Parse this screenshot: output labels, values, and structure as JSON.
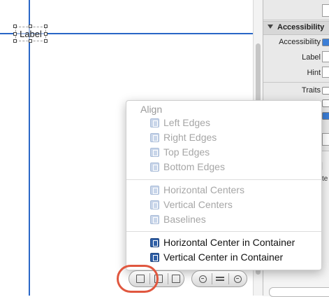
{
  "canvas": {
    "label_text": "Label"
  },
  "inspector": {
    "section_title": "Accessibility",
    "rows": {
      "accessibility": "Accessibility",
      "label": "Label",
      "hint": "Hint",
      "traits": "Traits"
    },
    "lower_fragment": "te"
  },
  "align_menu": {
    "title": "Align",
    "disabled_items": [
      {
        "label": "Left Edges",
        "icon": "align-left-edges-icon"
      },
      {
        "label": "Right Edges",
        "icon": "align-right-edges-icon"
      },
      {
        "label": "Top Edges",
        "icon": "align-top-edges-icon"
      },
      {
        "label": "Bottom Edges",
        "icon": "align-bottom-edges-icon"
      },
      {
        "label": "Horizontal Centers",
        "icon": "align-horizontal-centers-icon"
      },
      {
        "label": "Vertical Centers",
        "icon": "align-vertical-centers-icon"
      },
      {
        "label": "Baselines",
        "icon": "align-baselines-icon"
      }
    ],
    "enabled_items": [
      {
        "label": "Horizontal Center in Container",
        "icon": "center-horizontal-container-icon"
      },
      {
        "label": "Vertical Center in Container",
        "icon": "center-vertical-container-icon"
      }
    ]
  },
  "toolbar": {
    "align_button_icon": "align-icon",
    "pin_button_icon": "pin-icon",
    "resolve_button_icon": "resolve-icon",
    "zoom_out_icon": "zoom-out-icon",
    "zoom_actual_icon": "zoom-actual-size-icon",
    "zoom_in_icon": "zoom-in-icon",
    "highlight_color": "#e0573f"
  },
  "colors": {
    "guide": "#2a67c7",
    "accent": "#3c7ed6"
  }
}
